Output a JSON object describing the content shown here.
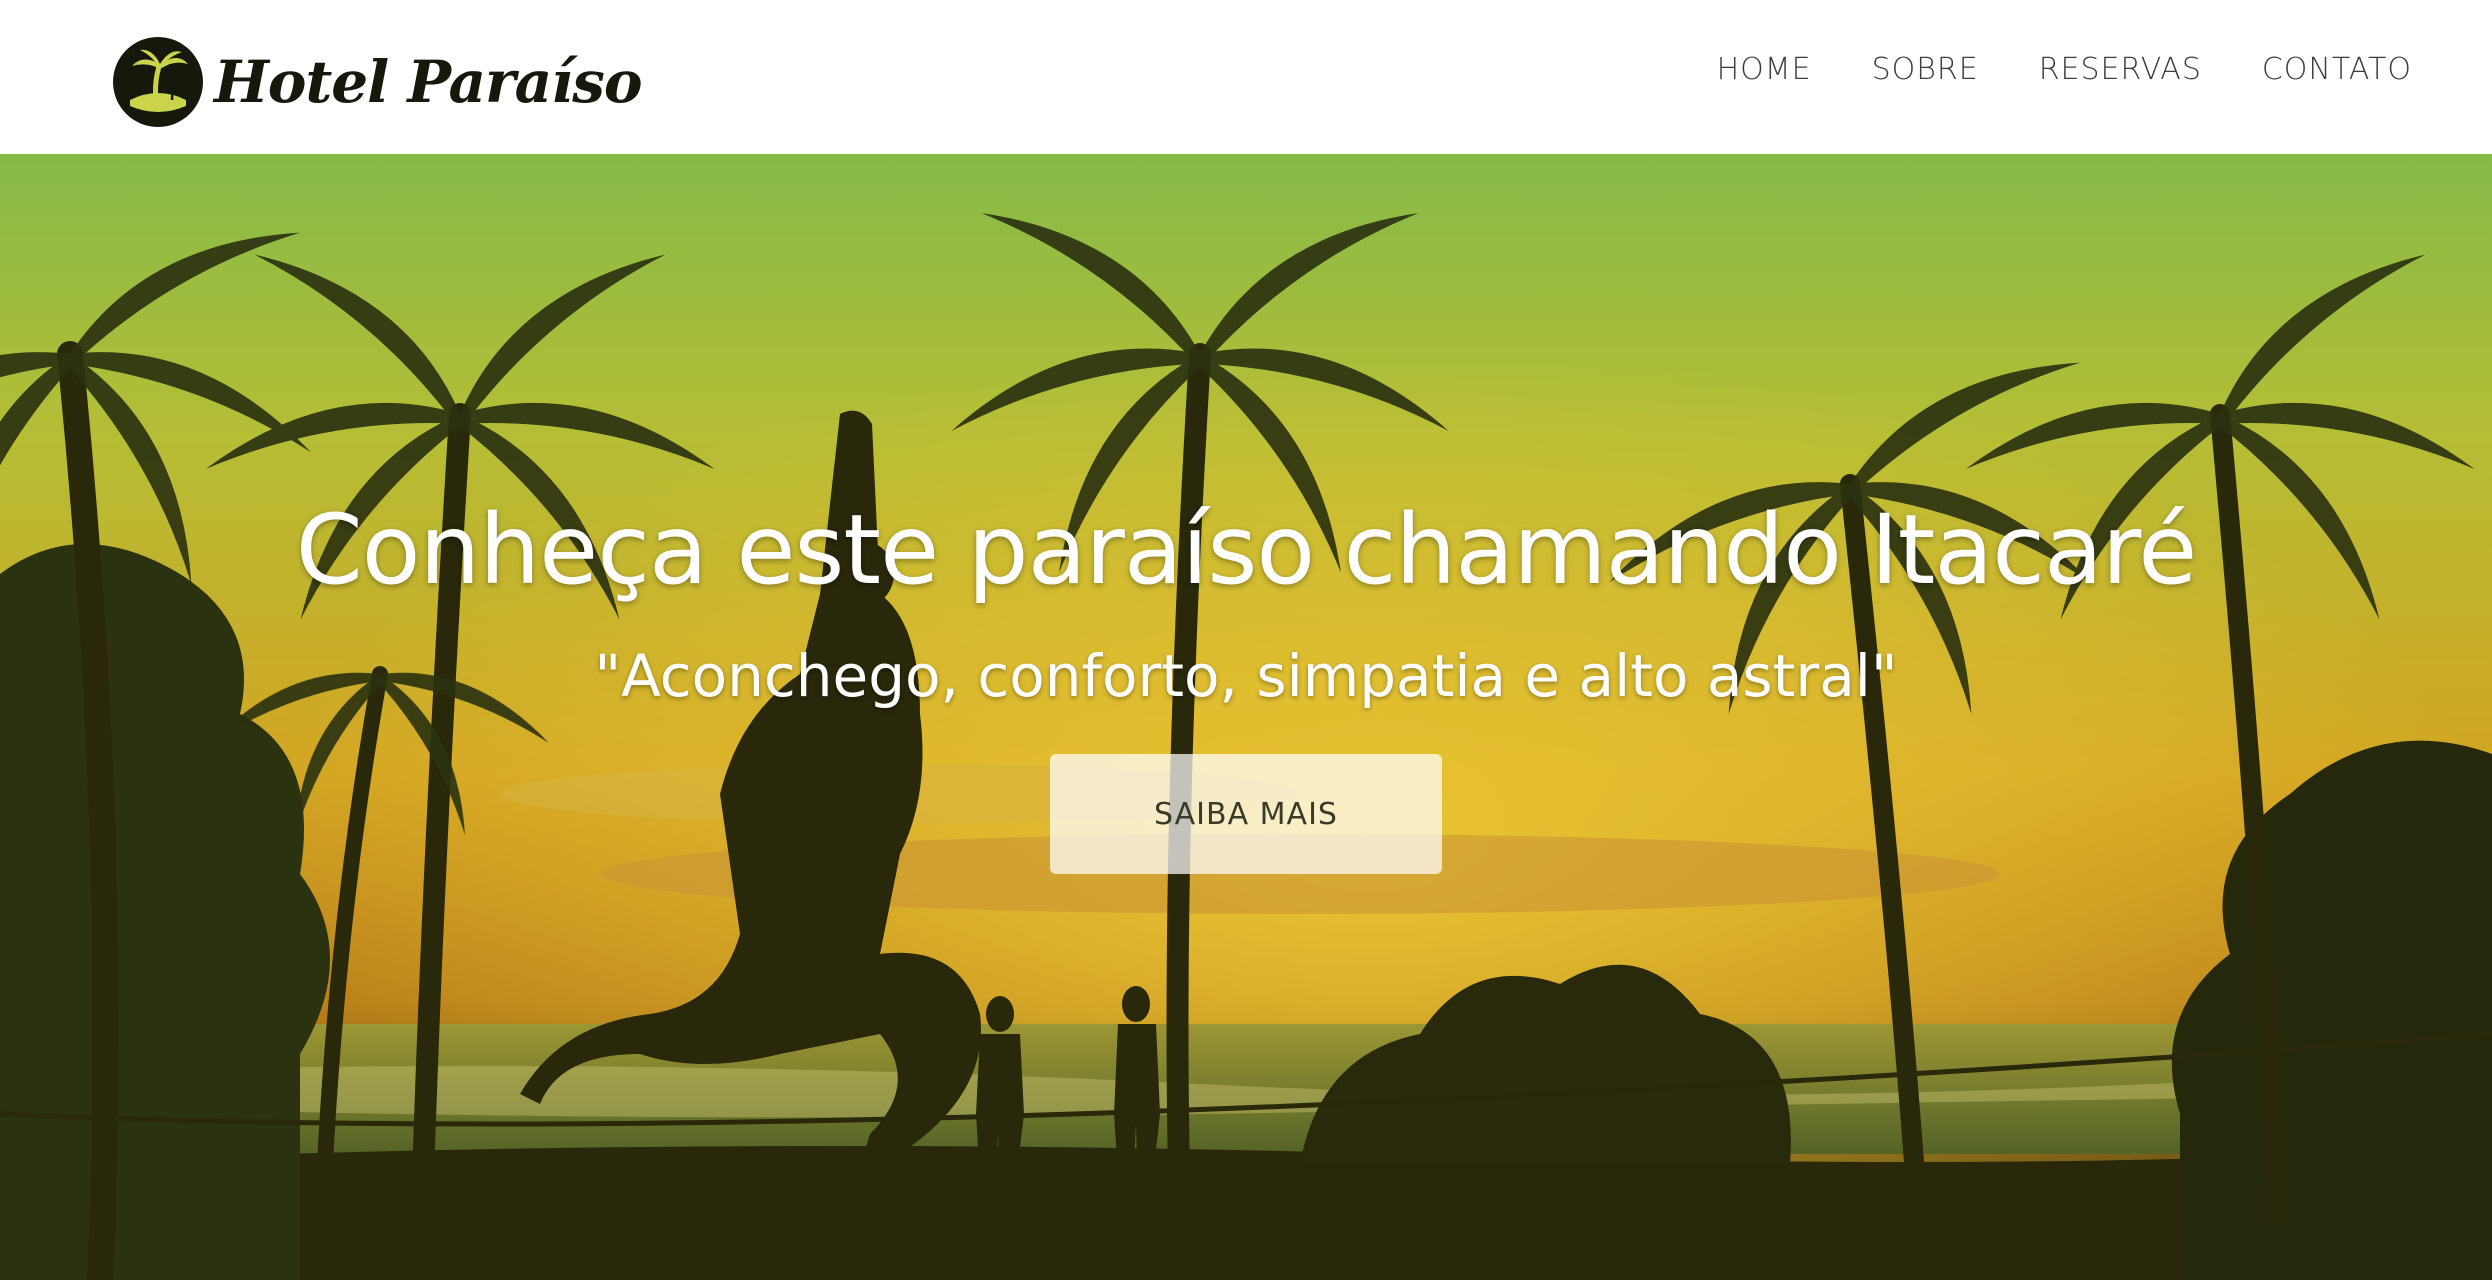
{
  "brand": {
    "name": "Hotel Paraíso",
    "logo_icon": "palm-tree-icon"
  },
  "nav": {
    "items": [
      {
        "label": "HOME"
      },
      {
        "label": "SOBRE"
      },
      {
        "label": "RESERVAS"
      },
      {
        "label": "CONTATO"
      }
    ]
  },
  "hero": {
    "title": "Conheça este paraíso chamando Itacaré",
    "subtitle": "\"Aconchego, conforto, simpatia e alto astral\"",
    "button_label": "SAIBA MAIS"
  },
  "colors": {
    "brand_dark": "#16180c",
    "logo_accent": "#c9d44a",
    "nav_text": "#3d3d3d",
    "hero_overlay_top": "#9fcf54",
    "hero_overlay_mid": "#e9b82a",
    "hero_overlay_bottom": "#2a2a0c"
  }
}
